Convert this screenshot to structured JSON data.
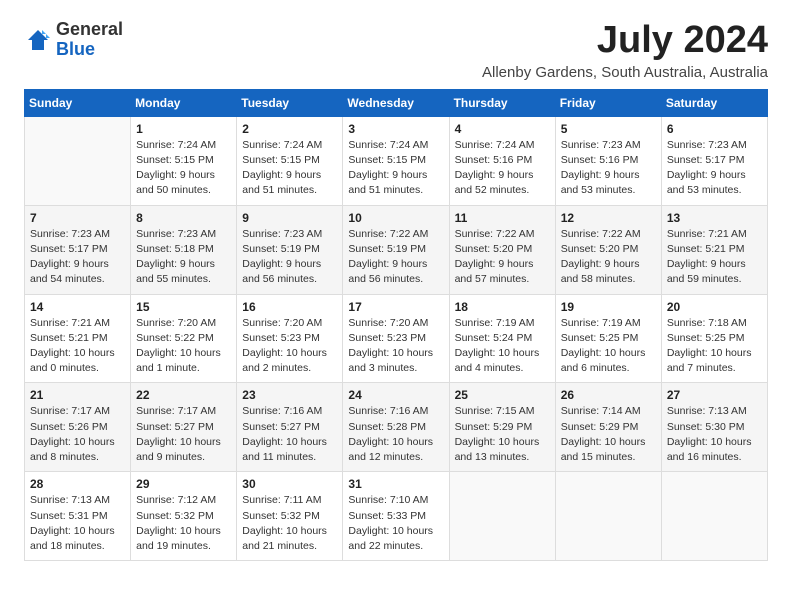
{
  "logo": {
    "general": "General",
    "blue": "Blue"
  },
  "header": {
    "month": "July 2024",
    "location": "Allenby Gardens, South Australia, Australia"
  },
  "weekdays": [
    "Sunday",
    "Monday",
    "Tuesday",
    "Wednesday",
    "Thursday",
    "Friday",
    "Saturday"
  ],
  "weeks": [
    [
      {
        "day": "",
        "sunrise": "",
        "sunset": "",
        "daylight": ""
      },
      {
        "day": "1",
        "sunrise": "Sunrise: 7:24 AM",
        "sunset": "Sunset: 5:15 PM",
        "daylight": "Daylight: 9 hours and 50 minutes."
      },
      {
        "day": "2",
        "sunrise": "Sunrise: 7:24 AM",
        "sunset": "Sunset: 5:15 PM",
        "daylight": "Daylight: 9 hours and 51 minutes."
      },
      {
        "day": "3",
        "sunrise": "Sunrise: 7:24 AM",
        "sunset": "Sunset: 5:15 PM",
        "daylight": "Daylight: 9 hours and 51 minutes."
      },
      {
        "day": "4",
        "sunrise": "Sunrise: 7:24 AM",
        "sunset": "Sunset: 5:16 PM",
        "daylight": "Daylight: 9 hours and 52 minutes."
      },
      {
        "day": "5",
        "sunrise": "Sunrise: 7:23 AM",
        "sunset": "Sunset: 5:16 PM",
        "daylight": "Daylight: 9 hours and 53 minutes."
      },
      {
        "day": "6",
        "sunrise": "Sunrise: 7:23 AM",
        "sunset": "Sunset: 5:17 PM",
        "daylight": "Daylight: 9 hours and 53 minutes."
      }
    ],
    [
      {
        "day": "7",
        "sunrise": "Sunrise: 7:23 AM",
        "sunset": "Sunset: 5:17 PM",
        "daylight": "Daylight: 9 hours and 54 minutes."
      },
      {
        "day": "8",
        "sunrise": "Sunrise: 7:23 AM",
        "sunset": "Sunset: 5:18 PM",
        "daylight": "Daylight: 9 hours and 55 minutes."
      },
      {
        "day": "9",
        "sunrise": "Sunrise: 7:23 AM",
        "sunset": "Sunset: 5:19 PM",
        "daylight": "Daylight: 9 hours and 56 minutes."
      },
      {
        "day": "10",
        "sunrise": "Sunrise: 7:22 AM",
        "sunset": "Sunset: 5:19 PM",
        "daylight": "Daylight: 9 hours and 56 minutes."
      },
      {
        "day": "11",
        "sunrise": "Sunrise: 7:22 AM",
        "sunset": "Sunset: 5:20 PM",
        "daylight": "Daylight: 9 hours and 57 minutes."
      },
      {
        "day": "12",
        "sunrise": "Sunrise: 7:22 AM",
        "sunset": "Sunset: 5:20 PM",
        "daylight": "Daylight: 9 hours and 58 minutes."
      },
      {
        "day": "13",
        "sunrise": "Sunrise: 7:21 AM",
        "sunset": "Sunset: 5:21 PM",
        "daylight": "Daylight: 9 hours and 59 minutes."
      }
    ],
    [
      {
        "day": "14",
        "sunrise": "Sunrise: 7:21 AM",
        "sunset": "Sunset: 5:21 PM",
        "daylight": "Daylight: 10 hours and 0 minutes."
      },
      {
        "day": "15",
        "sunrise": "Sunrise: 7:20 AM",
        "sunset": "Sunset: 5:22 PM",
        "daylight": "Daylight: 10 hours and 1 minute."
      },
      {
        "day": "16",
        "sunrise": "Sunrise: 7:20 AM",
        "sunset": "Sunset: 5:23 PM",
        "daylight": "Daylight: 10 hours and 2 minutes."
      },
      {
        "day": "17",
        "sunrise": "Sunrise: 7:20 AM",
        "sunset": "Sunset: 5:23 PM",
        "daylight": "Daylight: 10 hours and 3 minutes."
      },
      {
        "day": "18",
        "sunrise": "Sunrise: 7:19 AM",
        "sunset": "Sunset: 5:24 PM",
        "daylight": "Daylight: 10 hours and 4 minutes."
      },
      {
        "day": "19",
        "sunrise": "Sunrise: 7:19 AM",
        "sunset": "Sunset: 5:25 PM",
        "daylight": "Daylight: 10 hours and 6 minutes."
      },
      {
        "day": "20",
        "sunrise": "Sunrise: 7:18 AM",
        "sunset": "Sunset: 5:25 PM",
        "daylight": "Daylight: 10 hours and 7 minutes."
      }
    ],
    [
      {
        "day": "21",
        "sunrise": "Sunrise: 7:17 AM",
        "sunset": "Sunset: 5:26 PM",
        "daylight": "Daylight: 10 hours and 8 minutes."
      },
      {
        "day": "22",
        "sunrise": "Sunrise: 7:17 AM",
        "sunset": "Sunset: 5:27 PM",
        "daylight": "Daylight: 10 hours and 9 minutes."
      },
      {
        "day": "23",
        "sunrise": "Sunrise: 7:16 AM",
        "sunset": "Sunset: 5:27 PM",
        "daylight": "Daylight: 10 hours and 11 minutes."
      },
      {
        "day": "24",
        "sunrise": "Sunrise: 7:16 AM",
        "sunset": "Sunset: 5:28 PM",
        "daylight": "Daylight: 10 hours and 12 minutes."
      },
      {
        "day": "25",
        "sunrise": "Sunrise: 7:15 AM",
        "sunset": "Sunset: 5:29 PM",
        "daylight": "Daylight: 10 hours and 13 minutes."
      },
      {
        "day": "26",
        "sunrise": "Sunrise: 7:14 AM",
        "sunset": "Sunset: 5:29 PM",
        "daylight": "Daylight: 10 hours and 15 minutes."
      },
      {
        "day": "27",
        "sunrise": "Sunrise: 7:13 AM",
        "sunset": "Sunset: 5:30 PM",
        "daylight": "Daylight: 10 hours and 16 minutes."
      }
    ],
    [
      {
        "day": "28",
        "sunrise": "Sunrise: 7:13 AM",
        "sunset": "Sunset: 5:31 PM",
        "daylight": "Daylight: 10 hours and 18 minutes."
      },
      {
        "day": "29",
        "sunrise": "Sunrise: 7:12 AM",
        "sunset": "Sunset: 5:32 PM",
        "daylight": "Daylight: 10 hours and 19 minutes."
      },
      {
        "day": "30",
        "sunrise": "Sunrise: 7:11 AM",
        "sunset": "Sunset: 5:32 PM",
        "daylight": "Daylight: 10 hours and 21 minutes."
      },
      {
        "day": "31",
        "sunrise": "Sunrise: 7:10 AM",
        "sunset": "Sunset: 5:33 PM",
        "daylight": "Daylight: 10 hours and 22 minutes."
      },
      {
        "day": "",
        "sunrise": "",
        "sunset": "",
        "daylight": ""
      },
      {
        "day": "",
        "sunrise": "",
        "sunset": "",
        "daylight": ""
      },
      {
        "day": "",
        "sunrise": "",
        "sunset": "",
        "daylight": ""
      }
    ]
  ]
}
